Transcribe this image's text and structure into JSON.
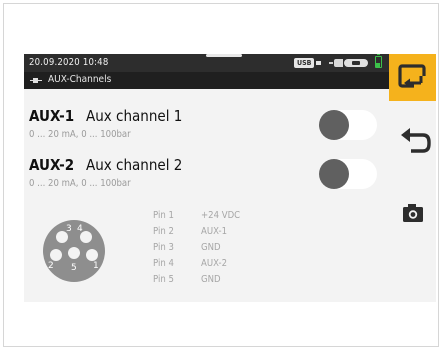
{
  "status_bar": {
    "datetime": "20.09.2020  10:48",
    "usb_badge": "USB"
  },
  "title_bar": {
    "title": "AUX-Channels"
  },
  "channels": [
    {
      "id": "AUX-1",
      "name": "Aux channel 1",
      "range": "0 ... 20 mA, 0 ... 100bar",
      "enabled": false
    },
    {
      "id": "AUX-2",
      "name": "Aux channel 2",
      "range": "0 ... 20 mA, 0 ... 100bar",
      "enabled": false
    }
  ],
  "connector": {
    "pin_numbers": [
      "1",
      "2",
      "3",
      "4",
      "5"
    ]
  },
  "pins": [
    {
      "label": "Pin 1",
      "value": "+24 VDC"
    },
    {
      "label": "Pin 2",
      "value": "AUX-1"
    },
    {
      "label": "Pin 3",
      "value": "GND"
    },
    {
      "label": "Pin 4",
      "value": "AUX-2"
    },
    {
      "label": "Pin 5",
      "value": "GND"
    }
  ],
  "sidebar": {
    "icons": [
      "export-icon",
      "back-arrow-icon",
      "camera-icon"
    ]
  },
  "colors": {
    "accent": "#f5b21c",
    "status_bar": "#2d2d2d",
    "title_bar": "#1f1f1f",
    "battery": "#3cc24a",
    "toggle_knob": "#606060"
  }
}
